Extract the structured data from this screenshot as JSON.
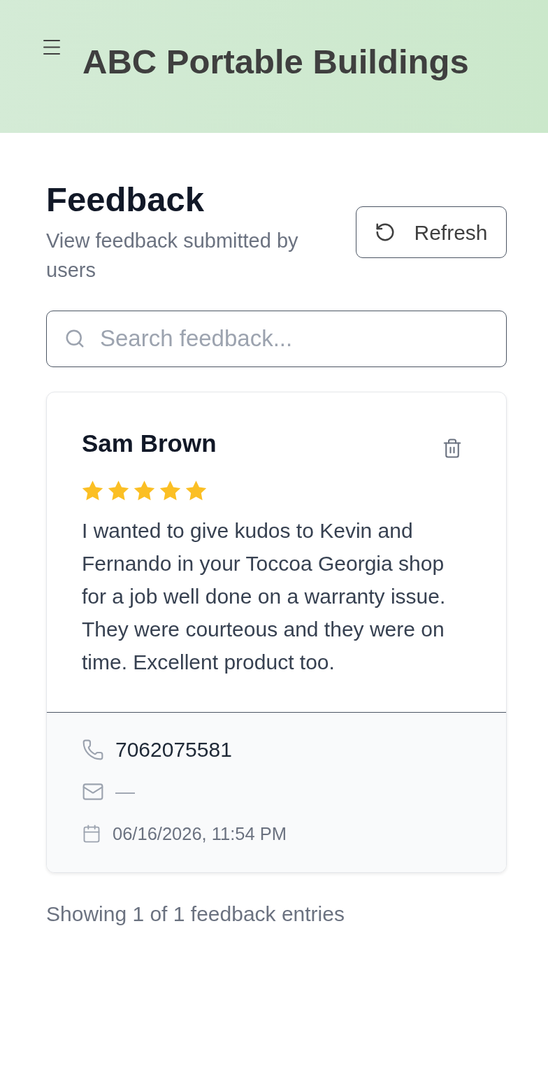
{
  "header": {
    "title": "ABC Portable Buildings"
  },
  "page": {
    "title": "Feedback",
    "subtitle": "View feedback submitted by users",
    "refresh_button": "Refresh"
  },
  "search": {
    "placeholder": "Search feedback..."
  },
  "feedback": [
    {
      "name": "Sam Brown",
      "stars": 5,
      "message": "I wanted to give kudos to Kevin and Fernando in your Toccoa Georgia shop for a job well done on a warranty issue. They were courteous and they were on time. Excellent product too.",
      "contact": [
        {
          "kind": "phone",
          "value": "7062075581"
        },
        {
          "kind": "email",
          "value": "—"
        },
        {
          "kind": "date",
          "value": "06/16/2026, 11:54 PM"
        }
      ]
    }
  ],
  "summary": "Showing 1 of 1 feedback entries"
}
